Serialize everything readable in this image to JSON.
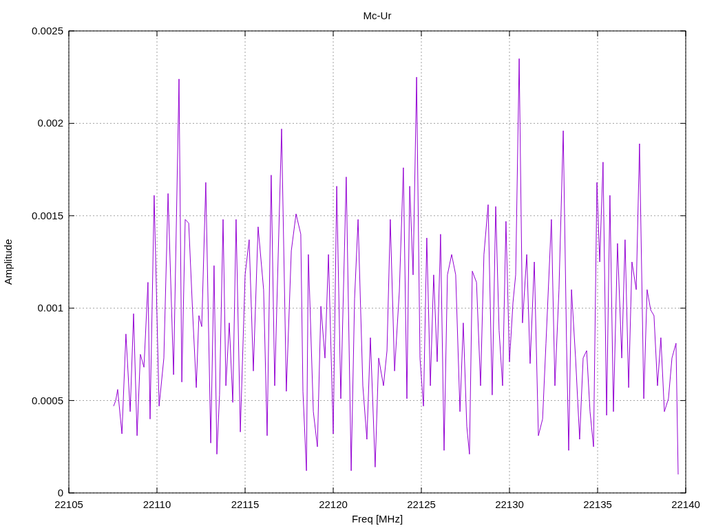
{
  "chart_data": {
    "type": "line",
    "title": "Mc-Ur",
    "xlabel": "Freq [MHz]",
    "ylabel": "Amplitude",
    "x": [
      22107.54,
      22107.66,
      22107.77,
      22108.01,
      22108.24,
      22108.48,
      22108.67,
      22108.87,
      22109.06,
      22109.26,
      22109.49,
      22109.61,
      22109.84,
      22110.12,
      22110.39,
      22110.63,
      22110.94,
      22111.25,
      22111.41,
      22111.6,
      22111.8,
      22112.03,
      22112.23,
      22112.38,
      22112.54,
      22112.77,
      22113.05,
      22113.24,
      22113.4,
      22113.55,
      22113.75,
      22113.91,
      22114.1,
      22114.3,
      22114.49,
      22114.73,
      22115.0,
      22115.23,
      22115.47,
      22115.74,
      22116.05,
      22116.25,
      22116.48,
      22116.68,
      22117.07,
      22117.34,
      22117.62,
      22117.89,
      22118.16,
      22118.28,
      22118.48,
      22118.59,
      22118.87,
      22119.1,
      22119.3,
      22119.53,
      22119.73,
      22120.0,
      22120.2,
      22120.43,
      22120.74,
      22121.02,
      22121.21,
      22121.41,
      22121.68,
      22121.91,
      22122.11,
      22122.38,
      22122.58,
      22122.85,
      22123.05,
      22123.24,
      22123.48,
      22123.75,
      22123.98,
      22124.18,
      22124.34,
      22124.53,
      22124.73,
      22124.92,
      22125.12,
      22125.31,
      22125.51,
      22125.7,
      22125.9,
      22126.09,
      22126.29,
      22126.48,
      22126.72,
      22126.95,
      22127.19,
      22127.38,
      22127.58,
      22127.73,
      22127.89,
      22128.13,
      22128.36,
      22128.55,
      22128.79,
      22129.02,
      22129.22,
      22129.41,
      22129.61,
      22129.8,
      22130.0,
      22130.2,
      22130.35,
      22130.55,
      22130.74,
      22130.98,
      22131.17,
      22131.41,
      22131.64,
      22131.88,
      22132.07,
      22132.38,
      22132.58,
      22132.81,
      22133.05,
      22133.24,
      22133.36,
      22133.52,
      22133.75,
      22133.98,
      22134.18,
      22134.38,
      22134.57,
      22134.77,
      22134.96,
      22135.12,
      22135.31,
      22135.51,
      22135.7,
      22135.9,
      22136.13,
      22136.37,
      22136.56,
      22136.76,
      22136.95,
      22137.19,
      22137.38,
      22137.62,
      22137.81,
      22138.01,
      22138.2,
      22138.4,
      22138.59,
      22138.79,
      22139.02,
      22139.22,
      22139.45,
      22139.57
    ],
    "series": [
      {
        "color": "#9400d3",
        "values": [
          0.00047,
          0.0005,
          0.00056,
          0.00032,
          0.00086,
          0.00044,
          0.00097,
          0.00031,
          0.00075,
          0.00068,
          0.00114,
          0.0004,
          0.00161,
          0.00047,
          0.00073,
          0.00162,
          0.00064,
          0.00224,
          0.0006,
          0.00148,
          0.00146,
          0.00096,
          0.00057,
          0.00096,
          0.0009,
          0.00168,
          0.00027,
          0.00123,
          0.00021,
          0.00053,
          0.00148,
          0.00058,
          0.00092,
          0.00049,
          0.00148,
          0.00033,
          0.00118,
          0.00137,
          0.00066,
          0.00144,
          0.0011,
          0.00031,
          0.00172,
          0.00058,
          0.00197,
          0.00055,
          0.00131,
          0.00151,
          0.0014,
          0.00055,
          0.00012,
          0.00129,
          0.00044,
          0.00025,
          0.00101,
          0.00073,
          0.00129,
          0.00032,
          0.00166,
          0.00051,
          0.00171,
          0.00012,
          0.00105,
          0.00148,
          0.00058,
          0.00029,
          0.00084,
          0.00014,
          0.00073,
          0.00058,
          0.00077,
          0.00148,
          0.00066,
          0.00109,
          0.00176,
          0.00051,
          0.00166,
          0.00118,
          0.00225,
          0.00073,
          0.00047,
          0.00138,
          0.00058,
          0.00118,
          0.00071,
          0.0014,
          0.00023,
          0.00118,
          0.00129,
          0.00118,
          0.00044,
          0.00092,
          0.00036,
          0.00021,
          0.0012,
          0.00114,
          0.00058,
          0.00129,
          0.00156,
          0.00053,
          0.00155,
          0.00088,
          0.00058,
          0.00147,
          0.00071,
          0.00103,
          0.00118,
          0.00235,
          0.00092,
          0.00129,
          0.0007,
          0.00125,
          0.00031,
          0.0004,
          0.00081,
          0.00148,
          0.00058,
          0.0011,
          0.00196,
          0.00081,
          0.00023,
          0.0011,
          0.00073,
          0.00029,
          0.00073,
          0.00077,
          0.00044,
          0.00025,
          0.00168,
          0.00125,
          0.00179,
          0.00042,
          0.00161,
          0.00044,
          0.00135,
          0.00073,
          0.00137,
          0.00057,
          0.00125,
          0.0011,
          0.00189,
          0.00051,
          0.0011,
          0.00099,
          0.00096,
          0.00058,
          0.00084,
          0.00044,
          0.00051,
          0.00073,
          0.00081,
          0.0001
        ]
      }
    ],
    "grid": true,
    "xlim": [
      22105,
      22140
    ],
    "ylim": [
      0,
      0.0025
    ],
    "xticks": [
      22105,
      22110,
      22115,
      22120,
      22125,
      22130,
      22135,
      22140
    ],
    "yticks": [
      0,
      0.0005,
      0.001,
      0.0015,
      0.002,
      0.0025
    ]
  }
}
